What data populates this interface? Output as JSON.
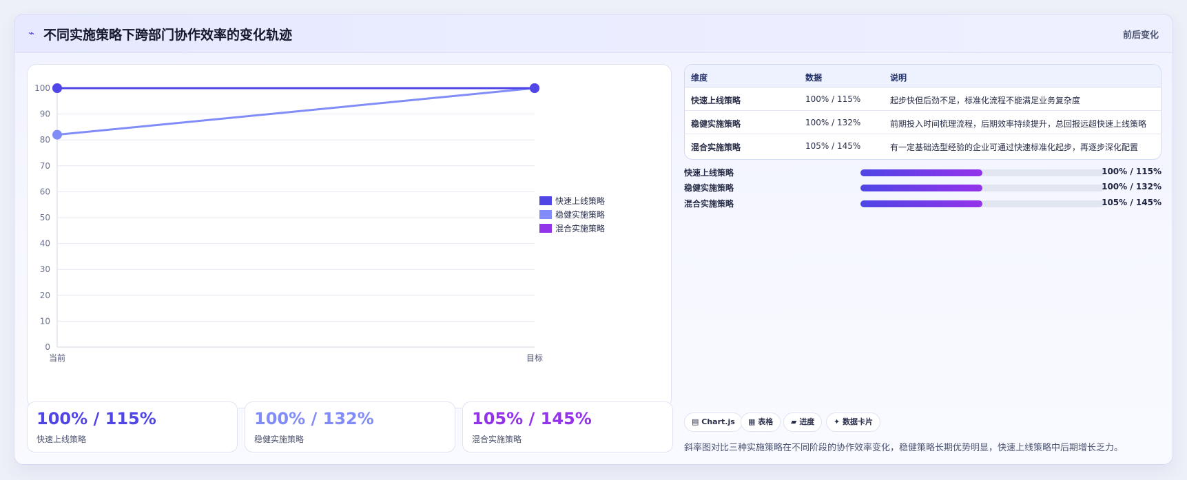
{
  "header": {
    "icon": "lightning-icon",
    "title": "不同实施策略下跨部门协作效率的变化轨迹",
    "tag": "前后变化"
  },
  "chart_data": {
    "type": "line",
    "categories": [
      "当前",
      "目标"
    ],
    "ylim": [
      0,
      100
    ],
    "yticks": [
      0,
      10,
      20,
      30,
      40,
      50,
      60,
      70,
      80,
      90,
      100
    ],
    "legend_position": "right",
    "series": [
      {
        "name": "快速上线策略",
        "values": [
          100,
          100
        ],
        "color": "#4f46e5"
      },
      {
        "name": "稳健实施策略",
        "values": [
          82,
          100
        ],
        "color": "#818cf8"
      },
      {
        "name": "混合实施策略",
        "values": [
          100,
          100
        ],
        "color": "#9333ea"
      }
    ]
  },
  "stats": [
    {
      "value": "100% / 115%",
      "label": "快速上线策略",
      "color": "#4f46e5"
    },
    {
      "value": "100% / 132%",
      "label": "稳健实施策略",
      "color": "#818cf8"
    },
    {
      "value": "105% / 145%",
      "label": "混合实施策略",
      "color": "#9333ea"
    }
  ],
  "table": {
    "headers": [
      "维度",
      "数据",
      "说明"
    ],
    "rows": [
      {
        "dim": "快速上线策略",
        "data": "100% / 115%",
        "desc": "起步快但后劲不足，标准化流程不能满足业务复杂度"
      },
      {
        "dim": "稳健实施策略",
        "data": "100% / 132%",
        "desc": "前期投入时间梳理流程，后期效率持续提升，总回报远超快速上线策略"
      },
      {
        "dim": "混合实施策略",
        "data": "105% / 145%",
        "desc": "有一定基础选型经验的企业可通过快速标准化起步，再逐步深化配置"
      }
    ]
  },
  "progress": [
    {
      "label": "快速上线策略",
      "value": "100% / 115%",
      "fraction": 0.5
    },
    {
      "label": "稳健实施策略",
      "value": "100% / 132%",
      "fraction": 0.5
    },
    {
      "label": "混合实施策略",
      "value": "105% / 145%",
      "fraction": 0.5
    }
  ],
  "chips": [
    {
      "icon": "chart-icon",
      "glyph": "▤",
      "label": "Chart.js"
    },
    {
      "icon": "table-icon",
      "glyph": "▦",
      "label": "表格"
    },
    {
      "icon": "progress-icon",
      "glyph": "▰",
      "label": "进度"
    },
    {
      "icon": "sparkle-icon",
      "glyph": "✦",
      "label": "数据卡片"
    }
  ],
  "note": "斜率图对比三种实施策略在不同阶段的协作效率变化，稳健策略长期优势明显，快速上线策略中后期增长乏力。"
}
